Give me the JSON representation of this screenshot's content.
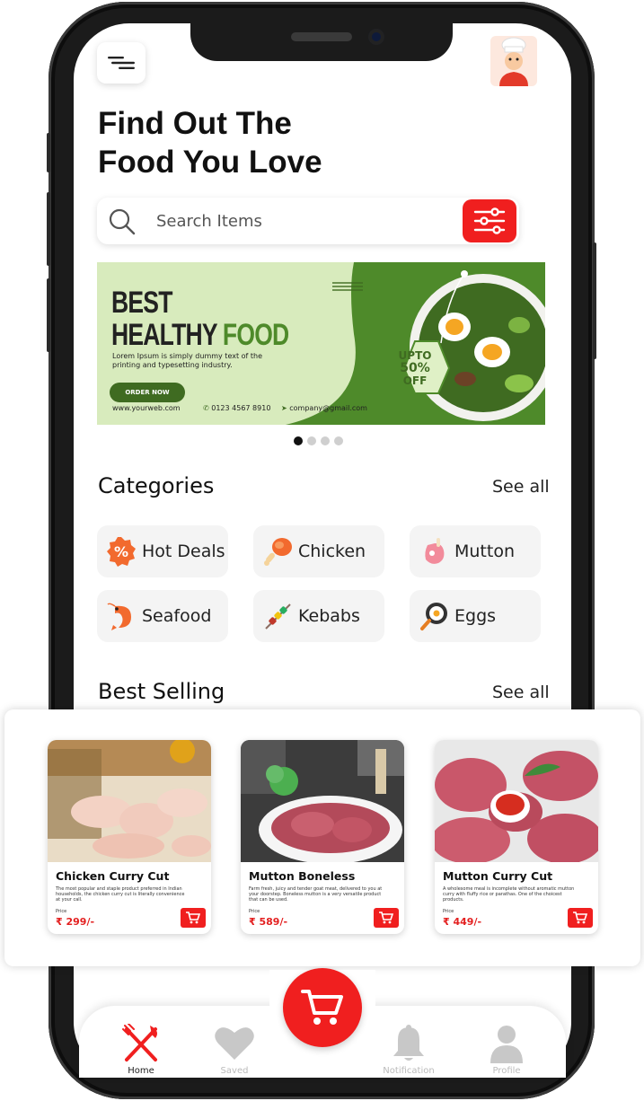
{
  "header": {
    "headline_line1": "Find Out The",
    "headline_line2": "Food You Love"
  },
  "search": {
    "placeholder": "Search Items",
    "value": ""
  },
  "banner": {
    "line1": "BEST",
    "line2_a": "HEALTHY ",
    "line2_b": "FOOD",
    "body": "Lorem Ipsum is simply dummy text of the printing and typesetting industry.",
    "cta": "ORDER NOW",
    "website": "www.yourweb.com",
    "phone": "0123 4567 8910",
    "email": "company@gmail.com",
    "badge_upto": "UPTO",
    "badge_percent": "50%",
    "badge_off": "OFF",
    "carousel_count": 4,
    "carousel_active": 1
  },
  "categories": {
    "title": "Categories",
    "see_all": "See all",
    "items": [
      {
        "label": "Hot Deals",
        "icon": "percent-badge-icon"
      },
      {
        "label": "Chicken",
        "icon": "chicken-leg-icon"
      },
      {
        "label": "Mutton",
        "icon": "mutton-icon"
      },
      {
        "label": "Seafood",
        "icon": "shrimp-icon"
      },
      {
        "label": "Kebabs",
        "icon": "kebab-icon"
      },
      {
        "label": "Eggs",
        "icon": "fried-egg-pan-icon"
      }
    ]
  },
  "best_selling": {
    "title": "Best Selling",
    "see_all": "See all",
    "price_label": "Price",
    "products": [
      {
        "name": "Chicken Curry Cut",
        "description": "The most popular and staple product preferred in Indian households, the chicken curry cut is literally convenience at your call.",
        "price": "₹ 299/-"
      },
      {
        "name": "Mutton Boneless",
        "description": "Farm fresh, juicy and tender goat meat, delivered to you at your doorstep. Boneless mutton is a very versatile product that can be used.",
        "price": "₹ 589/-"
      },
      {
        "name": "Mutton Curry Cut",
        "description": "A wholesome meal is incomplete without aromatic mutton curry with fluffy rice or parathas. One of the choicest products.",
        "price": "₹ 449/-"
      }
    ]
  },
  "bottom_nav": {
    "items": [
      {
        "label": "Home",
        "icon": "fork-knife-icon",
        "active": true
      },
      {
        "label": "Saved",
        "icon": "heart-icon",
        "active": false
      },
      {
        "label": "Notification",
        "icon": "bell-icon",
        "active": false
      },
      {
        "label": "Profile",
        "icon": "user-icon",
        "active": false
      }
    ],
    "center_icon": "cart-icon"
  },
  "colors": {
    "accent": "#f01f1f",
    "banner_green": "#4e8a2a",
    "banner_light": "#d8ebbd"
  }
}
